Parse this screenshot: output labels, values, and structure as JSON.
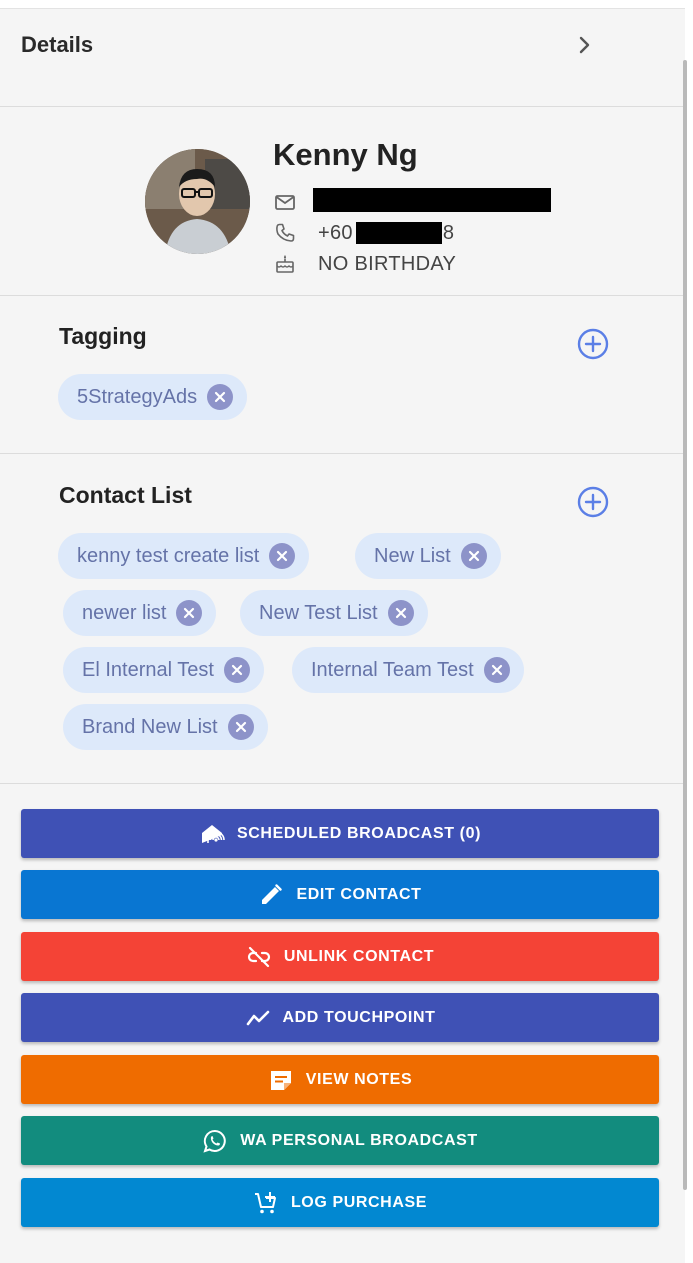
{
  "header": {
    "title": "Details"
  },
  "profile": {
    "name": "Kenny Ng",
    "phone_prefix": "+60",
    "phone_suffix": "8",
    "birthday": "NO BIRTHDAY"
  },
  "tagging": {
    "title": "Tagging",
    "tags": [
      "5StrategyAds"
    ]
  },
  "contact_list": {
    "title": "Contact List",
    "lists": [
      "kenny test create list",
      "New List",
      "newer list",
      "New Test List",
      "El Internal Test",
      "Internal Team Test",
      "Brand New List"
    ]
  },
  "actions": [
    {
      "label": "SCHEDULED BROADCAST (0)",
      "icon": "podcast-icon",
      "color": "#3f51b5"
    },
    {
      "label": "EDIT CONTACT",
      "icon": "pencil-icon",
      "color": "#0976d2"
    },
    {
      "label": "UNLINK CONTACT",
      "icon": "unlink-icon",
      "color": "#f44336"
    },
    {
      "label": "ADD TOUCHPOINT",
      "icon": "trend-line-icon",
      "color": "#3f51b5"
    },
    {
      "label": "VIEW NOTES",
      "icon": "note-icon",
      "color": "#ef6c00"
    },
    {
      "label": "WA PERSONAL BROADCAST",
      "icon": "whatsapp-icon",
      "color": "#128c7e"
    },
    {
      "label": "LOG PURCHASE",
      "icon": "cart-plus-icon",
      "color": "#0288d1"
    }
  ]
}
